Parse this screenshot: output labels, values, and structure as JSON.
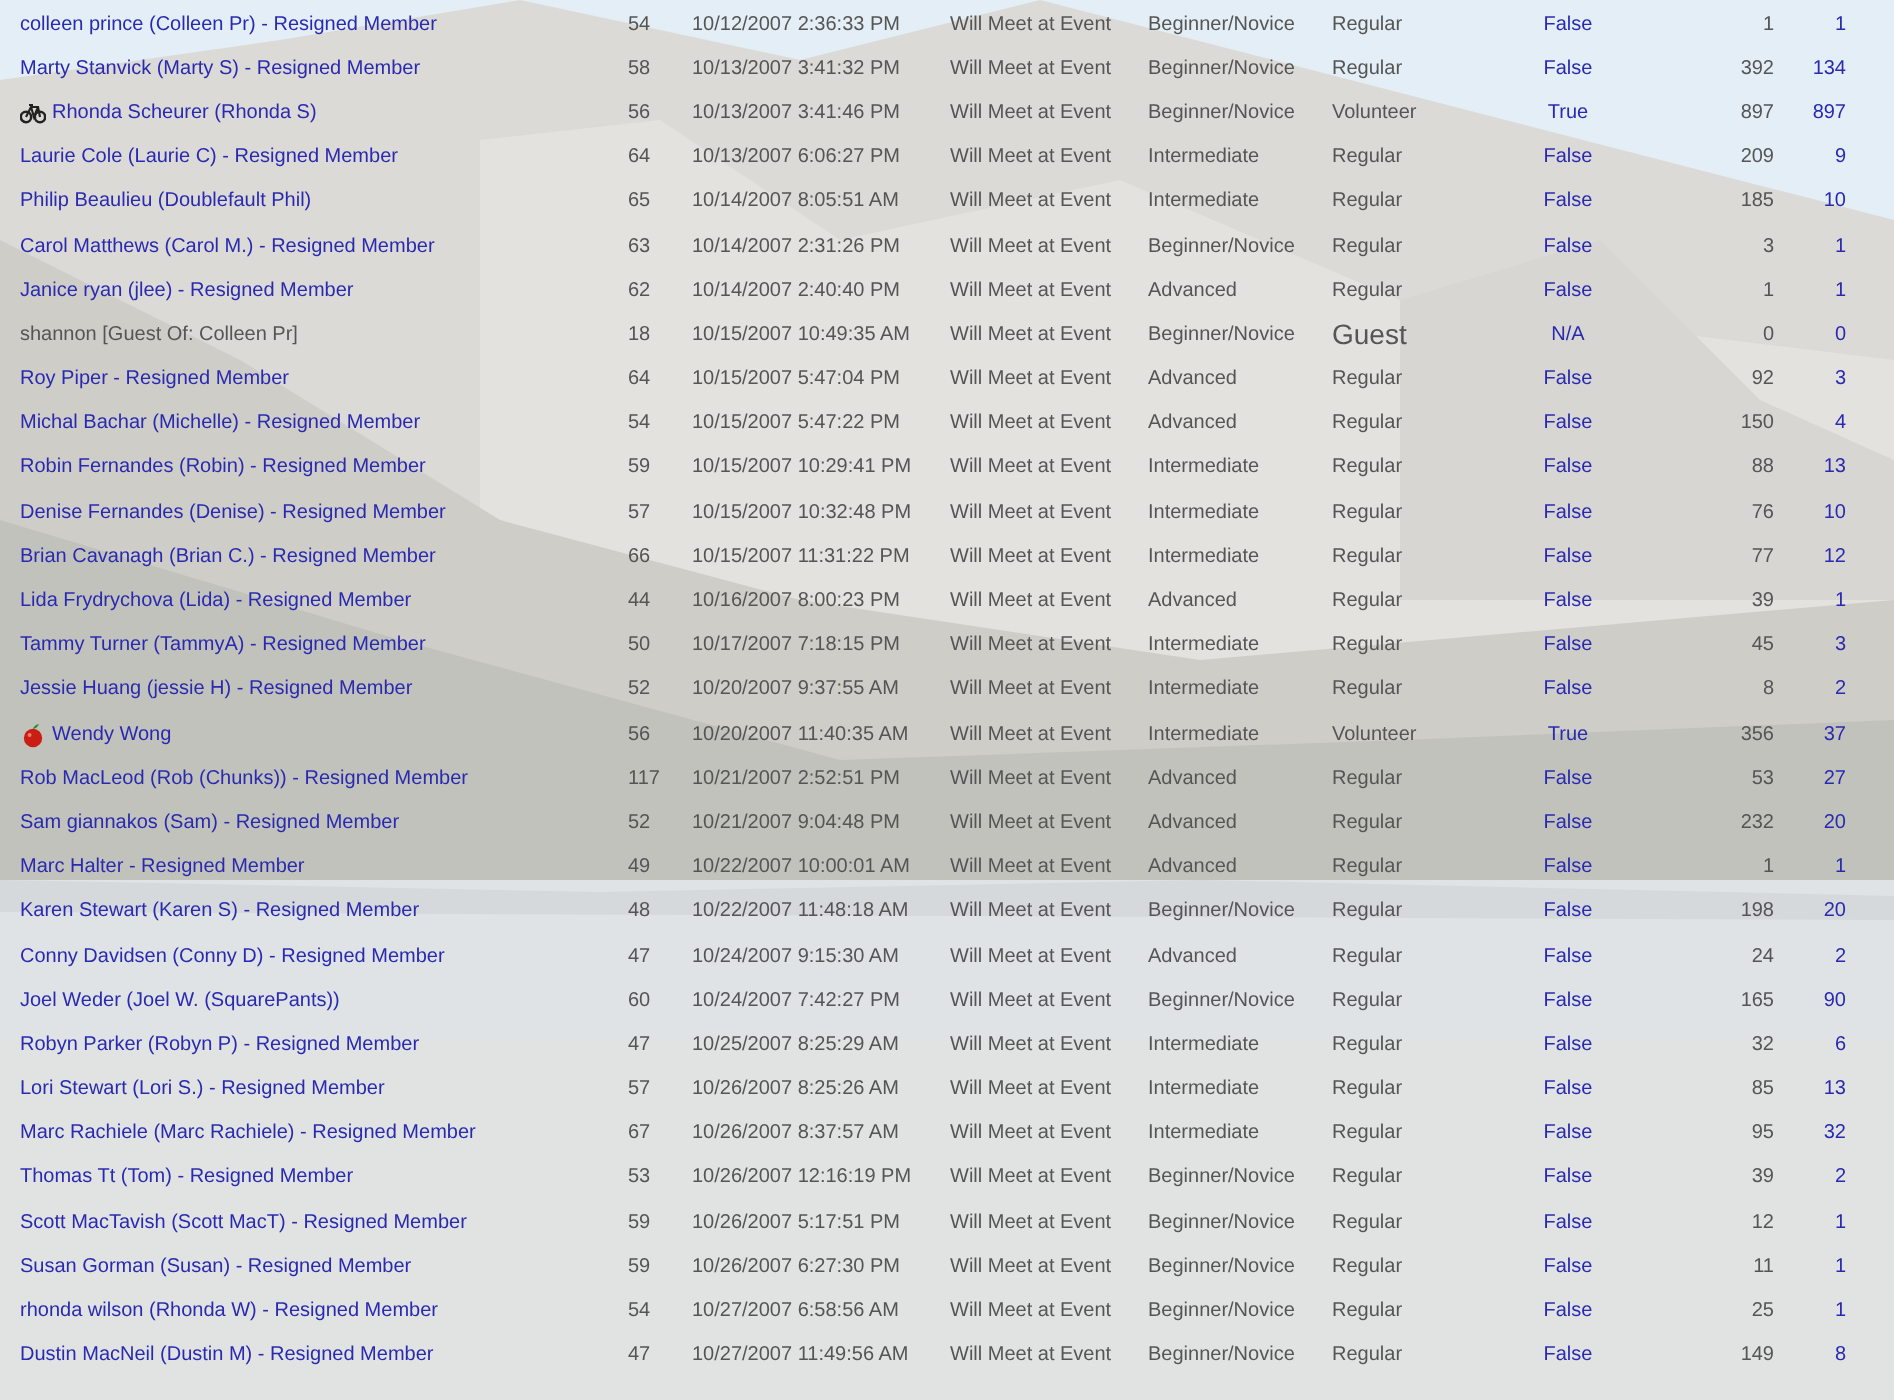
{
  "rows": [
    {
      "kind": "member",
      "column_1": "colleen prince (Colleen Pr) - Resigned Member",
      "column_2": "54",
      "column_3": "10/12/2007 2:36:33 PM",
      "column_4": "Will Meet at Event",
      "column_5": "Beginner/Novice",
      "column_6": "Regular",
      "column_7": "False",
      "column_8": "1",
      "column_9": "1"
    },
    {
      "kind": "member",
      "column_1": "Marty Stanvick (Marty S) - Resigned Member",
      "column_2": "58",
      "column_3": "10/13/2007 3:41:32 PM",
      "column_4": "Will Meet at Event",
      "column_5": "Beginner/Novice",
      "column_6": "Regular",
      "column_7": "False",
      "column_8": "392",
      "column_9": "134"
    },
    {
      "kind": "cyclist",
      "column_1": "Rhonda Scheurer (Rhonda S)",
      "column_2": "56",
      "column_3": "10/13/2007 3:41:46 PM",
      "column_4": "Will Meet at Event",
      "column_5": "Beginner/Novice",
      "column_6": "Volunteer",
      "column_7": "True",
      "column_8": "897",
      "column_9": "897"
    },
    {
      "kind": "member",
      "column_1": "Laurie Cole (Laurie C) - Resigned Member",
      "column_2": "64",
      "column_3": "10/13/2007 6:06:27 PM",
      "column_4": "Will Meet at Event",
      "column_5": "Intermediate",
      "column_6": "Regular",
      "column_7": "False",
      "column_8": "209",
      "column_9": "9"
    },
    {
      "kind": "member",
      "column_1": "Philip Beaulieu (Doublefault Phil)",
      "column_2": "65",
      "column_3": "10/14/2007 8:05:51 AM",
      "column_4": "Will Meet at Event",
      "column_5": "Intermediate",
      "column_6": "Regular",
      "column_7": "False",
      "column_8": "185",
      "column_9": "10"
    },
    {
      "kind": "member",
      "column_1": "Carol Matthews (Carol M.) - Resigned Member",
      "column_2": "63",
      "column_3": "10/14/2007 2:31:26 PM",
      "column_4": "Will Meet at Event",
      "column_5": "Beginner/Novice",
      "column_6": "Regular",
      "column_7": "False",
      "column_8": "3",
      "column_9": "1"
    },
    {
      "kind": "member",
      "column_1": "Janice ryan (jlee) - Resigned Member",
      "column_2": "62",
      "column_3": "10/14/2007 2:40:40 PM",
      "column_4": "Will Meet at Event",
      "column_5": "Advanced",
      "column_6": "Regular",
      "column_7": "False",
      "column_8": "1",
      "column_9": "1"
    },
    {
      "kind": "guest",
      "column_1": "shannon [Guest Of: Colleen Pr]",
      "column_2": "18",
      "column_3": "10/15/2007 10:49:35 AM",
      "column_4": "Will Meet at Event",
      "column_5": "Beginner/Novice",
      "column_6": "Guest",
      "column_7": "N/A",
      "column_8": "0",
      "column_9": "0"
    },
    {
      "kind": "member",
      "column_1": "Roy Piper - Resigned Member",
      "column_2": "64",
      "column_3": "10/15/2007 5:47:04 PM",
      "column_4": "Will Meet at Event",
      "column_5": "Advanced",
      "column_6": "Regular",
      "column_7": "False",
      "column_8": "92",
      "column_9": "3"
    },
    {
      "kind": "member",
      "column_1": "Michal Bachar (Michelle) - Resigned Member",
      "column_2": "54",
      "column_3": "10/15/2007 5:47:22 PM",
      "column_4": "Will Meet at Event",
      "column_5": "Advanced",
      "column_6": "Regular",
      "column_7": "False",
      "column_8": "150",
      "column_9": "4"
    },
    {
      "kind": "member",
      "column_1": "Robin Fernandes (Robin) - Resigned Member",
      "column_2": "59",
      "column_3": "10/15/2007 10:29:41 PM",
      "column_4": "Will Meet at Event",
      "column_5": "Intermediate",
      "column_6": "Regular",
      "column_7": "False",
      "column_8": "88",
      "column_9": "13"
    },
    {
      "kind": "member",
      "column_1": "Denise Fernandes (Denise) - Resigned Member",
      "column_2": "57",
      "column_3": "10/15/2007 10:32:48 PM",
      "column_4": "Will Meet at Event",
      "column_5": "Intermediate",
      "column_6": "Regular",
      "column_7": "False",
      "column_8": "76",
      "column_9": "10"
    },
    {
      "kind": "member",
      "column_1": "Brian Cavanagh (Brian C.) - Resigned Member",
      "column_2": "66",
      "column_3": "10/15/2007 11:31:22 PM",
      "column_4": "Will Meet at Event",
      "column_5": "Intermediate",
      "column_6": "Regular",
      "column_7": "False",
      "column_8": "77",
      "column_9": "12"
    },
    {
      "kind": "member",
      "column_1": "Lida Frydrychova (Lida) - Resigned Member",
      "column_2": "44",
      "column_3": "10/16/2007 8:00:23 PM",
      "column_4": "Will Meet at Event",
      "column_5": "Advanced",
      "column_6": "Regular",
      "column_7": "False",
      "column_8": "39",
      "column_9": "1"
    },
    {
      "kind": "member",
      "column_1": "Tammy Turner (TammyA) - Resigned Member",
      "column_2": "50",
      "column_3": "10/17/2007 7:18:15 PM",
      "column_4": "Will Meet at Event",
      "column_5": "Intermediate",
      "column_6": "Regular",
      "column_7": "False",
      "column_8": "45",
      "column_9": "3"
    },
    {
      "kind": "member",
      "column_1": "Jessie Huang (jessie H) - Resigned Member",
      "column_2": "52",
      "column_3": "10/20/2007 9:37:55 AM",
      "column_4": "Will Meet at Event",
      "column_5": "Intermediate",
      "column_6": "Regular",
      "column_7": "False",
      "column_8": "8",
      "column_9": "2"
    },
    {
      "kind": "fruit",
      "column_1": "Wendy Wong",
      "column_2": "56",
      "column_3": "10/20/2007 11:40:35 AM",
      "column_4": "Will Meet at Event",
      "column_5": "Intermediate",
      "column_6": "Volunteer",
      "column_7": "True",
      "column_8": "356",
      "column_9": "37"
    },
    {
      "kind": "member",
      "column_1": "Rob MacLeod (Rob (Chunks)) - Resigned Member",
      "column_2": "117",
      "column_3": "10/21/2007 2:52:51 PM",
      "column_4": "Will Meet at Event",
      "column_5": "Advanced",
      "column_6": "Regular",
      "column_7": "False",
      "column_8": "53",
      "column_9": "27"
    },
    {
      "kind": "member",
      "column_1": "Sam giannakos (Sam) - Resigned Member",
      "column_2": "52",
      "column_3": "10/21/2007 9:04:48 PM",
      "column_4": "Will Meet at Event",
      "column_5": "Advanced",
      "column_6": "Regular",
      "column_7": "False",
      "column_8": "232",
      "column_9": "20"
    },
    {
      "kind": "member",
      "column_1": "Marc Halter - Resigned Member",
      "column_2": "49",
      "column_3": "10/22/2007 10:00:01 AM",
      "column_4": "Will Meet at Event",
      "column_5": "Advanced",
      "column_6": "Regular",
      "column_7": "False",
      "column_8": "1",
      "column_9": "1"
    },
    {
      "kind": "member",
      "column_1": "Karen Stewart (Karen S) - Resigned Member",
      "column_2": "48",
      "column_3": "10/22/2007 11:48:18 AM",
      "column_4": "Will Meet at Event",
      "column_5": "Beginner/Novice",
      "column_6": "Regular",
      "column_7": "False",
      "column_8": "198",
      "column_9": "20"
    },
    {
      "kind": "member",
      "column_1": "Conny Davidsen (Conny D) - Resigned Member",
      "column_2": "47",
      "column_3": "10/24/2007 9:15:30 AM",
      "column_4": "Will Meet at Event",
      "column_5": "Advanced",
      "column_6": "Regular",
      "column_7": "False",
      "column_8": "24",
      "column_9": "2"
    },
    {
      "kind": "member",
      "column_1": "Joel Weder (Joel W. (SquarePants))",
      "column_2": "60",
      "column_3": "10/24/2007 7:42:27 PM",
      "column_4": "Will Meet at Event",
      "column_5": "Beginner/Novice",
      "column_6": "Regular",
      "column_7": "False",
      "column_8": "165",
      "column_9": "90"
    },
    {
      "kind": "member",
      "column_1": "Robyn Parker (Robyn P) - Resigned Member",
      "column_2": "47",
      "column_3": "10/25/2007 8:25:29 AM",
      "column_4": "Will Meet at Event",
      "column_5": "Intermediate",
      "column_6": "Regular",
      "column_7": "False",
      "column_8": "32",
      "column_9": "6"
    },
    {
      "kind": "member",
      "column_1": "Lori Stewart (Lori S.) - Resigned Member",
      "column_2": "57",
      "column_3": "10/26/2007 8:25:26 AM",
      "column_4": "Will Meet at Event",
      "column_5": "Intermediate",
      "column_6": "Regular",
      "column_7": "False",
      "column_8": "85",
      "column_9": "13"
    },
    {
      "kind": "member",
      "column_1": "Marc Rachiele (Marc Rachiele) - Resigned Member",
      "column_2": "67",
      "column_3": "10/26/2007 8:37:57 AM",
      "column_4": "Will Meet at Event",
      "column_5": "Intermediate",
      "column_6": "Regular",
      "column_7": "False",
      "column_8": "95",
      "column_9": "32"
    },
    {
      "kind": "member",
      "column_1": "Thomas Tt (Tom) - Resigned Member",
      "column_2": "53",
      "column_3": "10/26/2007 12:16:19 PM",
      "column_4": "Will Meet at Event",
      "column_5": "Beginner/Novice",
      "column_6": "Regular",
      "column_7": "False",
      "column_8": "39",
      "column_9": "2"
    },
    {
      "kind": "member",
      "column_1": "Scott MacTavish (Scott MacT) - Resigned Member",
      "column_2": "59",
      "column_3": "10/26/2007 5:17:51 PM",
      "column_4": "Will Meet at Event",
      "column_5": "Beginner/Novice",
      "column_6": "Regular",
      "column_7": "False",
      "column_8": "12",
      "column_9": "1"
    },
    {
      "kind": "member",
      "column_1": "Susan Gorman (Susan) - Resigned Member",
      "column_2": "59",
      "column_3": "10/26/2007 6:27:30 PM",
      "column_4": "Will Meet at Event",
      "column_5": "Beginner/Novice",
      "column_6": "Regular",
      "column_7": "False",
      "column_8": "11",
      "column_9": "1"
    },
    {
      "kind": "member",
      "column_1": "rhonda wilson (Rhonda W) - Resigned Member",
      "column_2": "54",
      "column_3": "10/27/2007 6:58:56 AM",
      "column_4": "Will Meet at Event",
      "column_5": "Beginner/Novice",
      "column_6": "Regular",
      "column_7": "False",
      "column_8": "25",
      "column_9": "1"
    },
    {
      "kind": "member",
      "column_1": "Dustin MacNeil (Dustin M) - Resigned Member",
      "column_2": "47",
      "column_3": "10/27/2007 11:49:56 AM",
      "column_4": "Will Meet at Event",
      "column_5": "Beginner/Novice",
      "column_6": "Regular",
      "column_7": "False",
      "column_8": "149",
      "column_9": "8"
    }
  ]
}
